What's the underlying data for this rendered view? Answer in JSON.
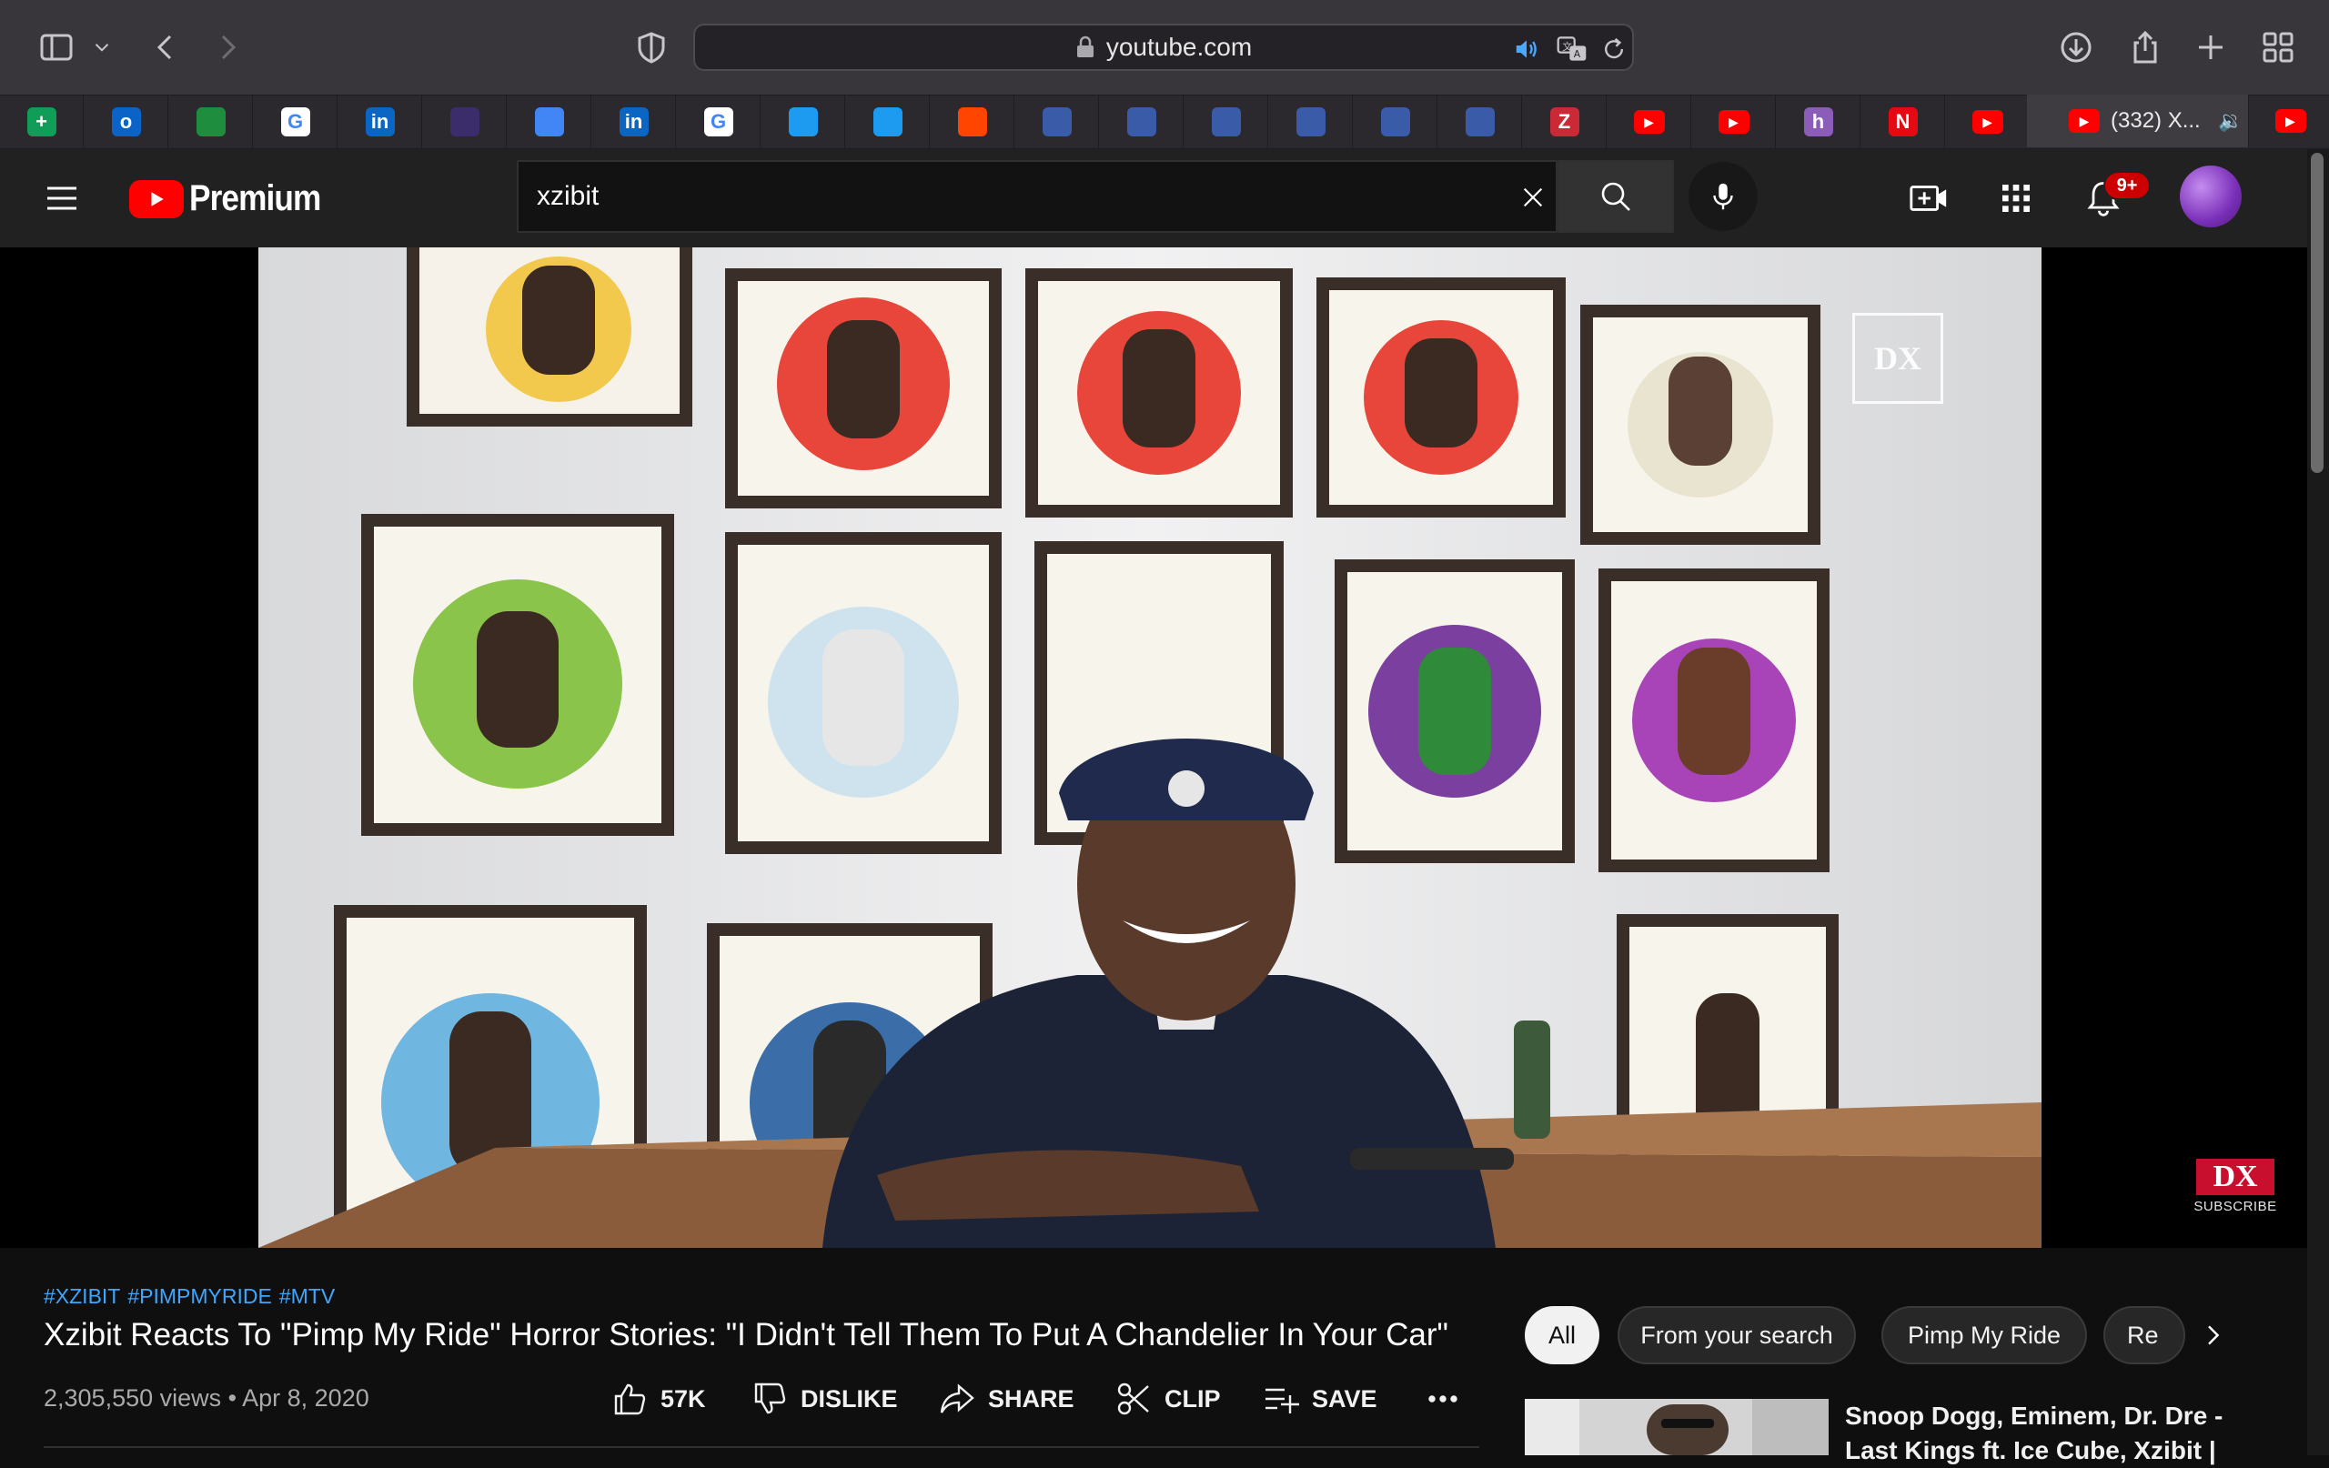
{
  "browser": {
    "url": "youtube.com",
    "active_tab_title": "(332) X...",
    "pinned_tabs": [
      {
        "icon": "google-sheets-icon",
        "color": "#0f9d58",
        "glyph": "+"
      },
      {
        "icon": "outlook-icon",
        "color": "#0a64c8",
        "glyph": "o"
      },
      {
        "icon": "classroom-icon",
        "color": "#1e8e3e",
        "glyph": ""
      },
      {
        "icon": "google-icon",
        "color": "#ffffff",
        "glyph": "G"
      },
      {
        "icon": "linkedin-icon",
        "color": "#0a66c2",
        "glyph": "in"
      },
      {
        "icon": "app-icon",
        "color": "#3b2c6b",
        "glyph": ""
      },
      {
        "icon": "google-docs-icon",
        "color": "#4285f4",
        "glyph": ""
      },
      {
        "icon": "linkedin-icon",
        "color": "#0a66c2",
        "glyph": "in"
      },
      {
        "icon": "google-icon",
        "color": "#ffffff",
        "glyph": "G"
      },
      {
        "icon": "twitter-icon",
        "color": "#1d9bf0",
        "glyph": ""
      },
      {
        "icon": "twitter-icon",
        "color": "#1d9bf0",
        "glyph": ""
      },
      {
        "icon": "reddit-icon",
        "color": "#ff4500",
        "glyph": ""
      },
      {
        "icon": "generic-page-icon",
        "color": "#3a5ba8",
        "glyph": ""
      },
      {
        "icon": "generic-page-icon",
        "color": "#3a5ba8",
        "glyph": ""
      },
      {
        "icon": "generic-page-icon",
        "color": "#3a5ba8",
        "glyph": ""
      },
      {
        "icon": "generic-page-icon",
        "color": "#3a5ba8",
        "glyph": ""
      },
      {
        "icon": "generic-page-icon",
        "color": "#3a5ba8",
        "glyph": ""
      },
      {
        "icon": "generic-page-icon",
        "color": "#3a5ba8",
        "glyph": ""
      },
      {
        "icon": "zotero-icon",
        "color": "#cc2936",
        "glyph": "Z"
      },
      {
        "icon": "youtube-icon",
        "color": "#ff0000",
        "glyph": "▶"
      },
      {
        "icon": "youtube-icon",
        "color": "#ff0000",
        "glyph": "▶"
      },
      {
        "icon": "hive-icon",
        "color": "#8b5cb8",
        "glyph": "h"
      },
      {
        "icon": "netflix-icon",
        "color": "#e50914",
        "glyph": "N"
      },
      {
        "icon": "youtube-icon",
        "color": "#ff0000",
        "glyph": "▶"
      }
    ]
  },
  "youtube": {
    "logo_text": "Premium",
    "search_value": "xzibit",
    "notification_count": "9+"
  },
  "video": {
    "watermark": "DX",
    "subscribe_logo": "DX",
    "subscribe_text": "SUBSCRIBE",
    "hashtags": [
      "#XZIBIT",
      "#PIMPMYRIDE",
      "#MTV"
    ],
    "title": "Xzibit Reacts To \"Pimp My Ride\" Horror Stories: \"I Didn't Tell Them To Put A Chandelier In Your Car\"",
    "views": "2,305,550 views",
    "date": "Apr 8, 2020",
    "actions": {
      "like": "57K",
      "dislike": "DISLIKE",
      "share": "SHARE",
      "clip": "CLIP",
      "save": "SAVE"
    }
  },
  "chips": [
    "All",
    "From your search",
    "Pimp My Ride",
    "Re"
  ],
  "related": {
    "title": "Snoop Dogg, Eminem, Dr. Dre - Last Kings ft. Ice Cube, Xzibit |"
  }
}
